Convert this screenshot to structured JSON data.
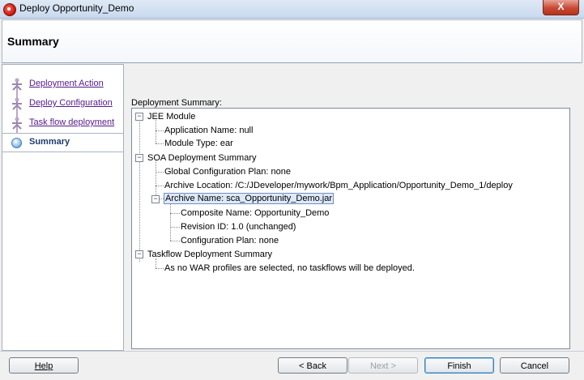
{
  "window": {
    "title": "Deploy Opportunity_Demo",
    "close_label": "X"
  },
  "header": {
    "title": "Summary"
  },
  "nav": {
    "items": [
      {
        "label": "Deployment Action",
        "state": "visited"
      },
      {
        "label": "Deploy Configuration",
        "state": "visited"
      },
      {
        "label": "Task flow deployment",
        "state": "visited"
      },
      {
        "label": "Summary",
        "state": "current"
      }
    ]
  },
  "content": {
    "summary_label": "Deployment Summary:",
    "tree": {
      "jee_module": "JEE Module",
      "application_name": "Application Name: null",
      "module_type": "Module Type: ear",
      "soa_summary": "SOA Deployment Summary",
      "global_config_plan": "Global Configuration Plan: none",
      "archive_location": "Archive Location: /C:/JDeveloper/mywork/Bpm_Application/Opportunity_Demo_1/deploy",
      "archive_name": "Archive Name: sca_Opportunity_Demo.jar",
      "composite_name": "Composite Name: Opportunity_Demo",
      "revision_id": "Revision ID: 1.0 (unchanged)",
      "configuration_plan": "Configuration Plan: none",
      "taskflow_summary": "Taskflow Deployment Summary",
      "taskflow_note": "As no WAR profiles are selected, no taskflows will be deployed."
    }
  },
  "buttons": {
    "help": "Help",
    "back": "< Back",
    "next": "Next >",
    "finish": "Finish",
    "cancel": "Cancel"
  }
}
